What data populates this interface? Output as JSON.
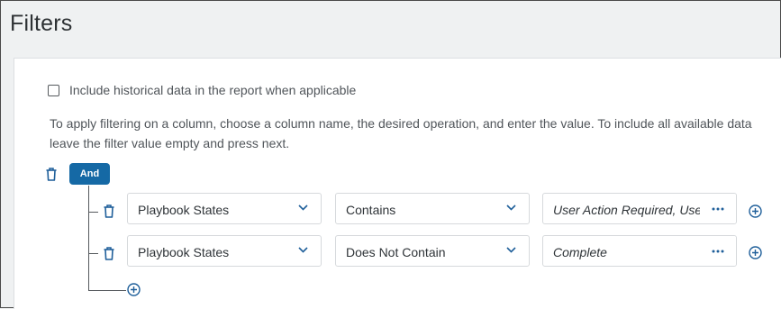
{
  "page": {
    "title": "Filters"
  },
  "historical": {
    "label": "Include historical data in the report when applicable",
    "checked": false
  },
  "instructions": "To apply filtering on a column, choose a column name, the desired operation, and enter the value. To include all available data leave the filter value empty and press next.",
  "group": {
    "operator_label": "And"
  },
  "conditions": [
    {
      "column": "Playbook States",
      "operation": "Contains",
      "value": "User Action Required, User Action Required"
    },
    {
      "column": "Playbook States",
      "operation": "Does Not Contain",
      "value": "Complete"
    }
  ],
  "colors": {
    "accent": "#1569a5",
    "icon": "#1f5f9a"
  },
  "icons": {
    "delete": "trash-icon",
    "dropdown": "chevron-down-icon",
    "more": "ellipsis-icon",
    "add": "plus-circle-icon"
  }
}
